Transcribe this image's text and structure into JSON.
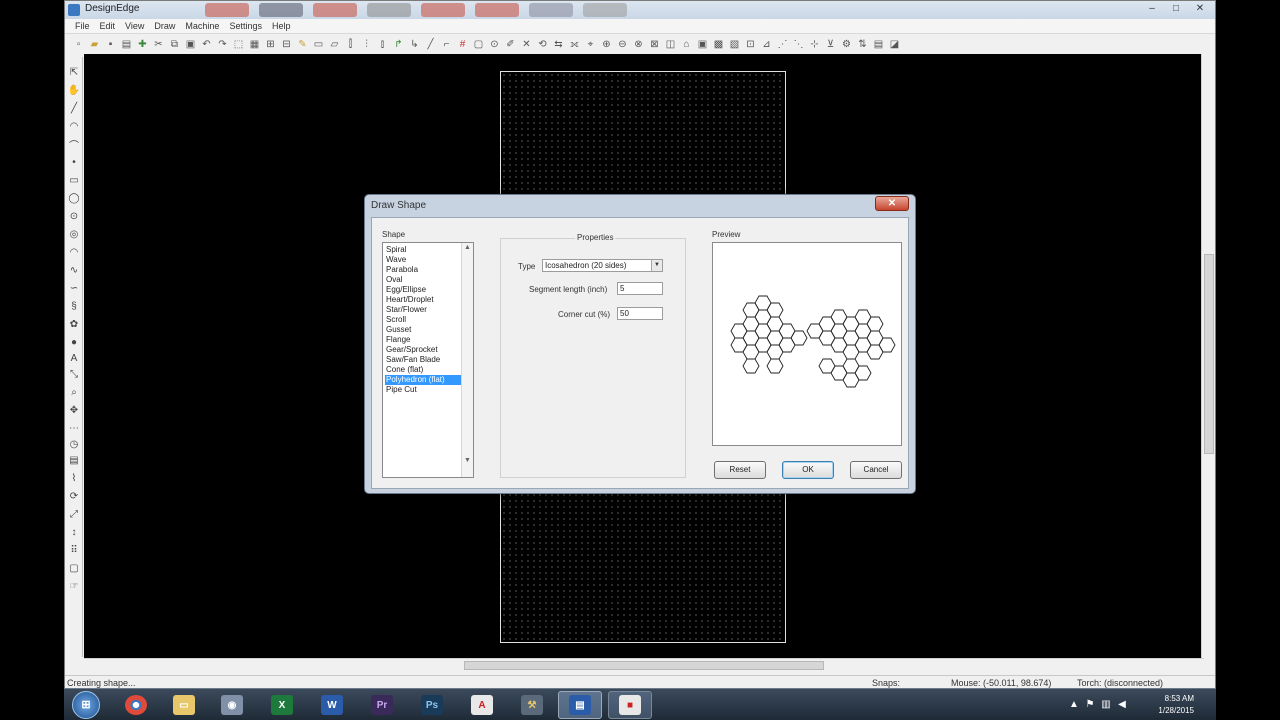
{
  "window": {
    "title": "DesignEdge"
  },
  "menu": [
    "File",
    "Edit",
    "View",
    "Draw",
    "Machine",
    "Settings",
    "Help"
  ],
  "dialog": {
    "title": "Draw Shape",
    "shape_label": "Shape",
    "shapes": [
      "Spiral",
      "Wave",
      "Parabola",
      "Oval",
      "Egg/Ellipse",
      "Heart/Droplet",
      "Star/Flower",
      "Scroll",
      "Gusset",
      "Flange",
      "Gear/Sprocket",
      "Saw/Fan Blade",
      "Cone (flat)",
      "Polyhedron (flat)",
      "Pipe Cut"
    ],
    "selected_shape": "Polyhedron (flat)",
    "properties_label": "Properties",
    "type_label": "Type",
    "type_value": "Icosahedron (20 sides)",
    "segment_label": "Segment length (inch)",
    "segment_value": "5",
    "corner_label": "Corner cut (%)",
    "corner_value": "50",
    "preview_label": "Preview",
    "reset_label": "Reset",
    "ok_label": "OK",
    "cancel_label": "Cancel"
  },
  "status": {
    "message": "Creating shape...",
    "snaps": "Snaps:",
    "mouse": "Mouse: (-50.011, 98.674)",
    "torch": "Torch: (disconnected)"
  },
  "taskbar": {
    "time": "8:53 AM",
    "date": "1/28/2015"
  }
}
